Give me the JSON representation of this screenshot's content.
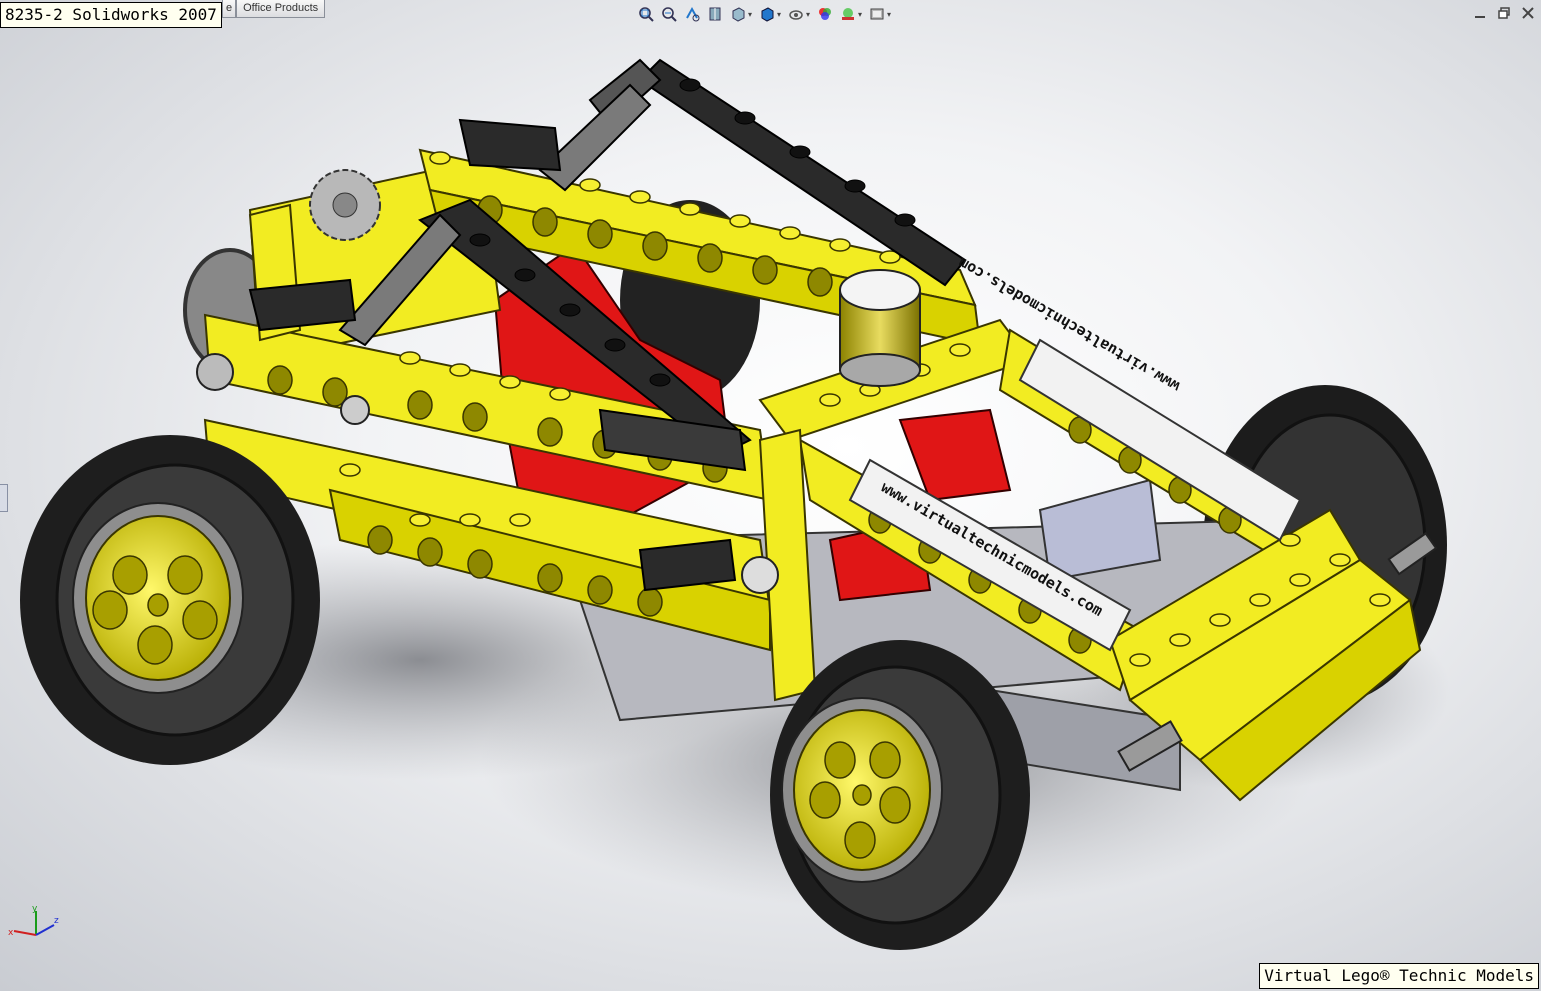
{
  "captions": {
    "title": "8235-2 Solidworks 2007",
    "credit": "Virtual Lego® Technic Models"
  },
  "tabs": {
    "stub": "e",
    "office": "Office Products"
  },
  "model": {
    "decal_text": "www.virtualtechnicmodels.com",
    "colors": {
      "yellow": "#f2ec22",
      "yellow_dark": "#b8b000",
      "black": "#2a2a2a",
      "red": "#e01616",
      "grey": "#8a8a8a"
    }
  },
  "toolbar_icons": [
    "zoom-to-fit-icon",
    "zoom-area-icon",
    "previous-view-icon",
    "section-view-icon",
    "view-orientation-icon",
    "display-style-icon",
    "hide-show-icon",
    "edit-appearance-icon",
    "apply-scene-icon",
    "view-settings-icon"
  ],
  "triad": {
    "x": "x",
    "y": "y",
    "z": "z"
  }
}
